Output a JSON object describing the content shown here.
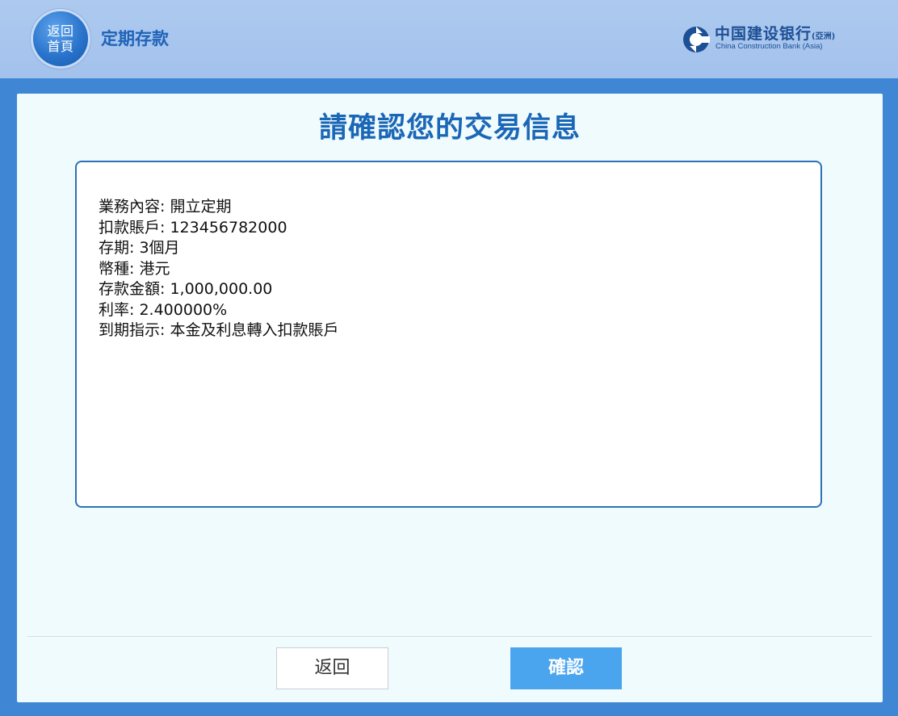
{
  "header": {
    "home_button": {
      "line1": "返回",
      "line2": "首頁"
    },
    "title": "定期存款",
    "brand": {
      "name_cn": "中国建设银行",
      "name_cn_suffix": "(亞洲)",
      "name_en": "China Construction Bank (Asia)",
      "logo_icon": "ccb-logo-icon",
      "color": "#1d4f95"
    }
  },
  "main": {
    "title": "請確認您的交易信息",
    "details": [
      {
        "label": "業務內容",
        "value": "開立定期"
      },
      {
        "label": "扣款賬戶",
        "value": "123456782000"
      },
      {
        "label": "存期",
        "value": "3個月"
      },
      {
        "label": "幣種",
        "value": "港元"
      },
      {
        "label": "存款金額",
        "value": "1,000,000.00"
      },
      {
        "label": "利率",
        "value": "2.400000%"
      },
      {
        "label": "到期指示",
        "value": "本金及利息轉入扣款賬戶"
      }
    ],
    "separator": ": "
  },
  "footer": {
    "back_label": "返回",
    "confirm_label": "確認"
  },
  "colors": {
    "accent": "#1b67b7",
    "confirm_button": "#4aa4ee",
    "header_bg": "#a3c2ec",
    "frame_bg": "#3f86d4"
  }
}
